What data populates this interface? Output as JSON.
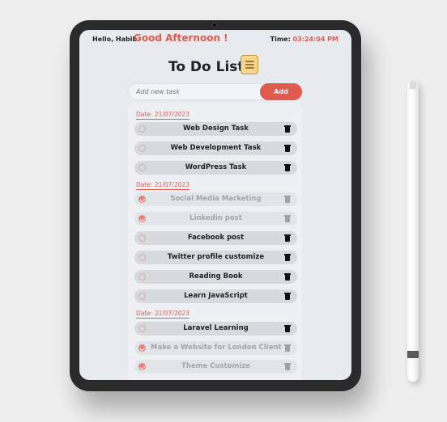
{
  "header": {
    "hello": "Hello, Habib",
    "greeting": "Good Afternoon !",
    "time_label": "Time:",
    "time_value": "03:24:04 PM"
  },
  "app": {
    "title": "To Do List",
    "icon": "notepad-icon",
    "input_placeholder": "Add new task",
    "add_label": "Add"
  },
  "groups": [
    {
      "date": "Date: 21/07/2023",
      "tasks": [
        {
          "label": "Web Design Task",
          "done": false
        },
        {
          "label": "Web Development Task",
          "done": false
        },
        {
          "label": "WordPress Task",
          "done": false
        }
      ]
    },
    {
      "date": "Date: 21/07/2023",
      "tasks": [
        {
          "label": "Social Media Marketing",
          "done": true
        },
        {
          "label": "Linkedin post",
          "done": true
        },
        {
          "label": "Facebook post",
          "done": false
        },
        {
          "label": "Twitter profile customize",
          "done": false
        },
        {
          "label": "Reading Book",
          "done": false
        },
        {
          "label": "Learn JavaScript",
          "done": false
        }
      ]
    },
    {
      "date": "Date: 21/07/2023",
      "tasks": [
        {
          "label": "Laravel Learning",
          "done": false
        },
        {
          "label": "Make a Website for London Client",
          "done": true
        },
        {
          "label": "Theme Customize",
          "done": true
        }
      ]
    }
  ],
  "colors": {
    "accent": "#e05a4e",
    "task_background": "#d6dade",
    "screen_background": "#e7eaef"
  }
}
